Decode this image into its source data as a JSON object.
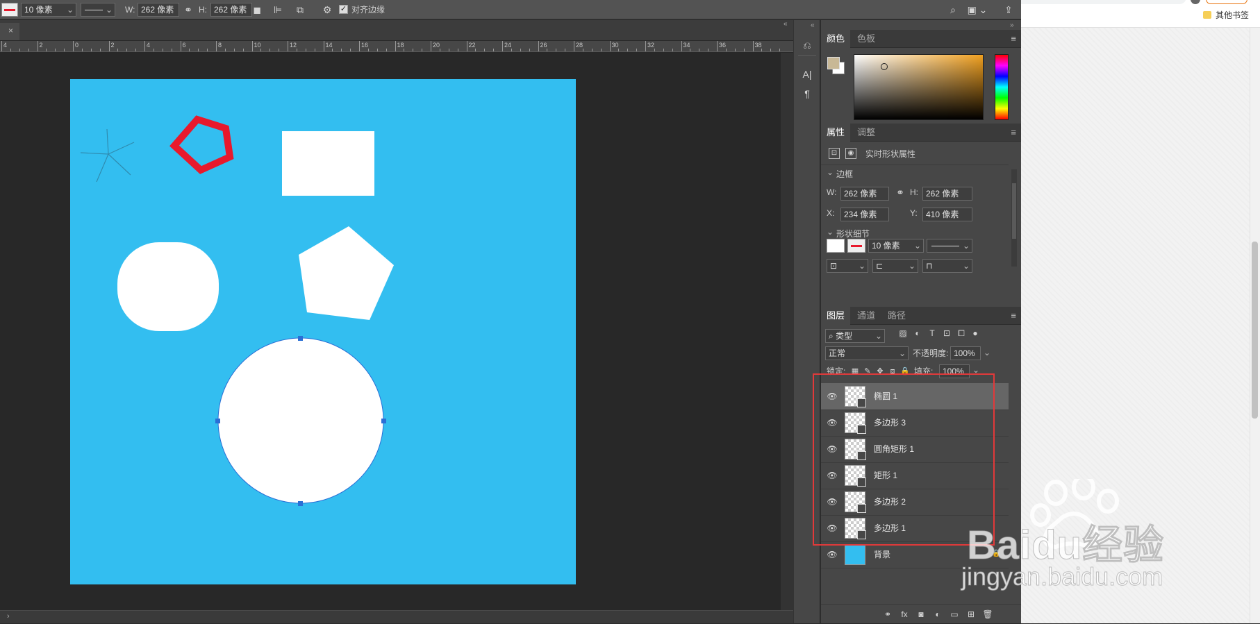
{
  "options_bar": {
    "stroke_width": "10 像素",
    "w_label": "W:",
    "w_value": "262 像素",
    "h_label": "H:",
    "h_value": "262 像素",
    "align_edges_label": "对齐边缘"
  },
  "document_tab": {
    "close": "×"
  },
  "ruler": {
    "ticks": [
      "4",
      "2",
      "0",
      "2",
      "4",
      "6",
      "8",
      "10",
      "12",
      "14",
      "16",
      "18",
      "20",
      "22",
      "24",
      "26",
      "28",
      "30",
      "32",
      "34",
      "36",
      "38"
    ]
  },
  "color_panel": {
    "tabs": [
      "颜色",
      "色板"
    ],
    "foreground": "#c8b896",
    "background": "#ffffff"
  },
  "properties_panel": {
    "tabs": [
      "属性",
      "调整"
    ],
    "title": "实时形状属性",
    "bounds_section": "边框",
    "w_label": "W:",
    "w_value": "262 像素",
    "h_label": "H:",
    "h_value": "262 像素",
    "x_label": "X:",
    "x_value": "234 像素",
    "y_label": "Y:",
    "y_value": "410 像素",
    "shape_section": "形状细节",
    "stroke_width": "10 像素"
  },
  "layers_panel": {
    "tabs": [
      "图层",
      "通道",
      "路径"
    ],
    "filter_kind": "类型",
    "blend_mode": "正常",
    "opacity_label": "不透明度:",
    "opacity_value": "100%",
    "lock_label": "锁定:",
    "fill_label": "填充:",
    "fill_value": "100%",
    "layers": [
      {
        "name": "椭圆 1",
        "selected": true
      },
      {
        "name": "多边形 3",
        "selected": false
      },
      {
        "name": "圆角矩形 1",
        "selected": false
      },
      {
        "name": "矩形 1",
        "selected": false
      },
      {
        "name": "多边形 2",
        "selected": false
      },
      {
        "name": "多边形 1",
        "selected": false
      },
      {
        "name": "背景",
        "selected": false
      }
    ]
  },
  "canvas": {
    "background_color": "#33bef0",
    "shape_color": "#ffffff",
    "stroke_color": "#e8192c"
  },
  "browser": {
    "bookmark_label": "其他书签"
  },
  "watermark": {
    "brand": "Baidu经验",
    "url": "jingyan.baidu.com"
  }
}
